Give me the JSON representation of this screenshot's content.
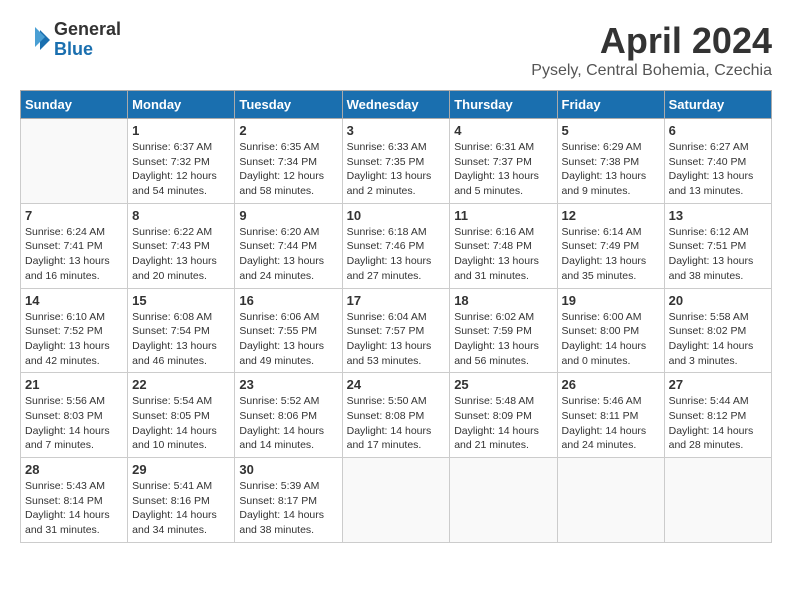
{
  "logo": {
    "general": "General",
    "blue": "Blue"
  },
  "title": "April 2024",
  "location": "Pysely, Central Bohemia, Czechia",
  "days_of_week": [
    "Sunday",
    "Monday",
    "Tuesday",
    "Wednesday",
    "Thursday",
    "Friday",
    "Saturday"
  ],
  "weeks": [
    [
      {
        "day": "",
        "info": ""
      },
      {
        "day": "1",
        "info": "Sunrise: 6:37 AM\nSunset: 7:32 PM\nDaylight: 12 hours\nand 54 minutes."
      },
      {
        "day": "2",
        "info": "Sunrise: 6:35 AM\nSunset: 7:34 PM\nDaylight: 12 hours\nand 58 minutes."
      },
      {
        "day": "3",
        "info": "Sunrise: 6:33 AM\nSunset: 7:35 PM\nDaylight: 13 hours\nand 2 minutes."
      },
      {
        "day": "4",
        "info": "Sunrise: 6:31 AM\nSunset: 7:37 PM\nDaylight: 13 hours\nand 5 minutes."
      },
      {
        "day": "5",
        "info": "Sunrise: 6:29 AM\nSunset: 7:38 PM\nDaylight: 13 hours\nand 9 minutes."
      },
      {
        "day": "6",
        "info": "Sunrise: 6:27 AM\nSunset: 7:40 PM\nDaylight: 13 hours\nand 13 minutes."
      }
    ],
    [
      {
        "day": "7",
        "info": "Sunrise: 6:24 AM\nSunset: 7:41 PM\nDaylight: 13 hours\nand 16 minutes."
      },
      {
        "day": "8",
        "info": "Sunrise: 6:22 AM\nSunset: 7:43 PM\nDaylight: 13 hours\nand 20 minutes."
      },
      {
        "day": "9",
        "info": "Sunrise: 6:20 AM\nSunset: 7:44 PM\nDaylight: 13 hours\nand 24 minutes."
      },
      {
        "day": "10",
        "info": "Sunrise: 6:18 AM\nSunset: 7:46 PM\nDaylight: 13 hours\nand 27 minutes."
      },
      {
        "day": "11",
        "info": "Sunrise: 6:16 AM\nSunset: 7:48 PM\nDaylight: 13 hours\nand 31 minutes."
      },
      {
        "day": "12",
        "info": "Sunrise: 6:14 AM\nSunset: 7:49 PM\nDaylight: 13 hours\nand 35 minutes."
      },
      {
        "day": "13",
        "info": "Sunrise: 6:12 AM\nSunset: 7:51 PM\nDaylight: 13 hours\nand 38 minutes."
      }
    ],
    [
      {
        "day": "14",
        "info": "Sunrise: 6:10 AM\nSunset: 7:52 PM\nDaylight: 13 hours\nand 42 minutes."
      },
      {
        "day": "15",
        "info": "Sunrise: 6:08 AM\nSunset: 7:54 PM\nDaylight: 13 hours\nand 46 minutes."
      },
      {
        "day": "16",
        "info": "Sunrise: 6:06 AM\nSunset: 7:55 PM\nDaylight: 13 hours\nand 49 minutes."
      },
      {
        "day": "17",
        "info": "Sunrise: 6:04 AM\nSunset: 7:57 PM\nDaylight: 13 hours\nand 53 minutes."
      },
      {
        "day": "18",
        "info": "Sunrise: 6:02 AM\nSunset: 7:59 PM\nDaylight: 13 hours\nand 56 minutes."
      },
      {
        "day": "19",
        "info": "Sunrise: 6:00 AM\nSunset: 8:00 PM\nDaylight: 14 hours\nand 0 minutes."
      },
      {
        "day": "20",
        "info": "Sunrise: 5:58 AM\nSunset: 8:02 PM\nDaylight: 14 hours\nand 3 minutes."
      }
    ],
    [
      {
        "day": "21",
        "info": "Sunrise: 5:56 AM\nSunset: 8:03 PM\nDaylight: 14 hours\nand 7 minutes."
      },
      {
        "day": "22",
        "info": "Sunrise: 5:54 AM\nSunset: 8:05 PM\nDaylight: 14 hours\nand 10 minutes."
      },
      {
        "day": "23",
        "info": "Sunrise: 5:52 AM\nSunset: 8:06 PM\nDaylight: 14 hours\nand 14 minutes."
      },
      {
        "day": "24",
        "info": "Sunrise: 5:50 AM\nSunset: 8:08 PM\nDaylight: 14 hours\nand 17 minutes."
      },
      {
        "day": "25",
        "info": "Sunrise: 5:48 AM\nSunset: 8:09 PM\nDaylight: 14 hours\nand 21 minutes."
      },
      {
        "day": "26",
        "info": "Sunrise: 5:46 AM\nSunset: 8:11 PM\nDaylight: 14 hours\nand 24 minutes."
      },
      {
        "day": "27",
        "info": "Sunrise: 5:44 AM\nSunset: 8:12 PM\nDaylight: 14 hours\nand 28 minutes."
      }
    ],
    [
      {
        "day": "28",
        "info": "Sunrise: 5:43 AM\nSunset: 8:14 PM\nDaylight: 14 hours\nand 31 minutes."
      },
      {
        "day": "29",
        "info": "Sunrise: 5:41 AM\nSunset: 8:16 PM\nDaylight: 14 hours\nand 34 minutes."
      },
      {
        "day": "30",
        "info": "Sunrise: 5:39 AM\nSunset: 8:17 PM\nDaylight: 14 hours\nand 38 minutes."
      },
      {
        "day": "",
        "info": ""
      },
      {
        "day": "",
        "info": ""
      },
      {
        "day": "",
        "info": ""
      },
      {
        "day": "",
        "info": ""
      }
    ]
  ]
}
